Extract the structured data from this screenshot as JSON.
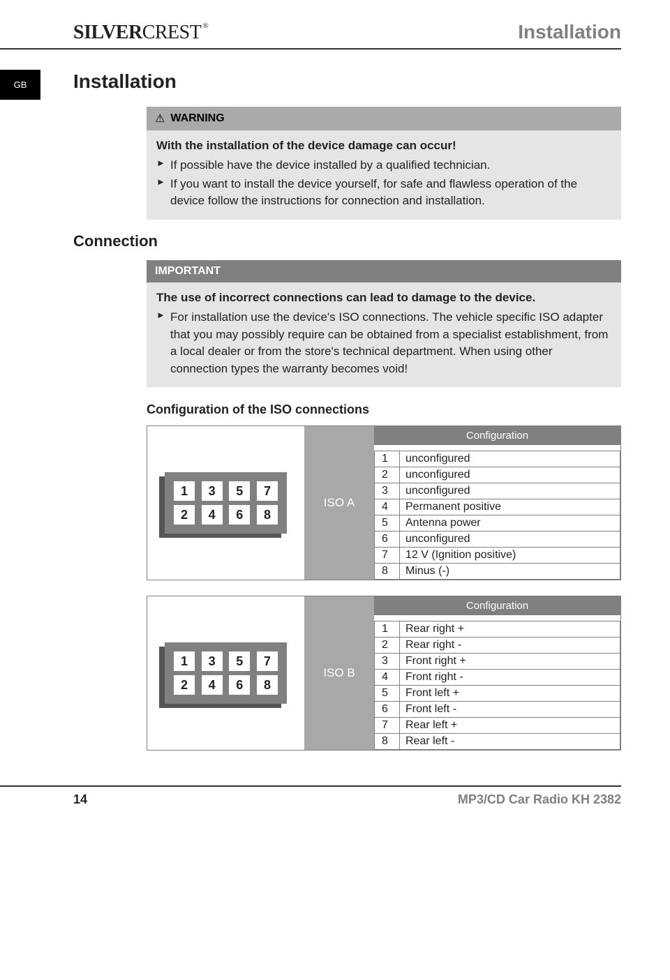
{
  "header": {
    "brand_a": "SILVER",
    "brand_b": "CREST",
    "reg": "®",
    "section": "Installation"
  },
  "tab": "GB",
  "h1": "Installation",
  "warning": {
    "label": "WARNING",
    "lead": "With the installation of the device damage can occur!",
    "bullets": [
      "If possible have the device installed by a qualified technician.",
      "If you want to install the device yourself, for safe and flawless operation of the device follow the instructions for connection and installation."
    ]
  },
  "h2": "Connection",
  "important": {
    "label": "IMPORTANT",
    "lead": "The use of incorrect connections can lead to damage to the device.",
    "bullets": [
      "For installation use the device's ISO connections. The vehicle specific ISO adapter that you may possibly require can be obtained from a specialist establishment, from a local dealer or from the store's technical department. When using other connection types the warranty becomes void!"
    ]
  },
  "h3": "Configuration of the ISO connections",
  "connector_pins": {
    "top": [
      "1",
      "3",
      "5",
      "7"
    ],
    "bottom": [
      "2",
      "4",
      "6",
      "8"
    ]
  },
  "iso_a": {
    "label": "ISO A",
    "header": "Configuration",
    "rows": [
      {
        "n": "1",
        "v": "unconfigured"
      },
      {
        "n": "2",
        "v": "unconfigured"
      },
      {
        "n": "3",
        "v": "unconfigured"
      },
      {
        "n": "4",
        "v": "Permanent positive"
      },
      {
        "n": "5",
        "v": "Antenna power"
      },
      {
        "n": "6",
        "v": "unconfigured"
      },
      {
        "n": "7",
        "v": "12 V (Ignition positive)"
      },
      {
        "n": "8",
        "v": "Minus (-)"
      }
    ]
  },
  "iso_b": {
    "label": "ISO B",
    "header": "Configuration",
    "rows": [
      {
        "n": "1",
        "v": "Rear right +"
      },
      {
        "n": "2",
        "v": "Rear right -"
      },
      {
        "n": "3",
        "v": "Front right +"
      },
      {
        "n": "4",
        "v": "Front right -"
      },
      {
        "n": "5",
        "v": "Front left +"
      },
      {
        "n": "6",
        "v": "Front left -"
      },
      {
        "n": "7",
        "v": "Rear left +"
      },
      {
        "n": "8",
        "v": "Rear left -"
      }
    ]
  },
  "footer": {
    "page": "14",
    "product": "MP3/CD Car Radio KH 2382"
  }
}
